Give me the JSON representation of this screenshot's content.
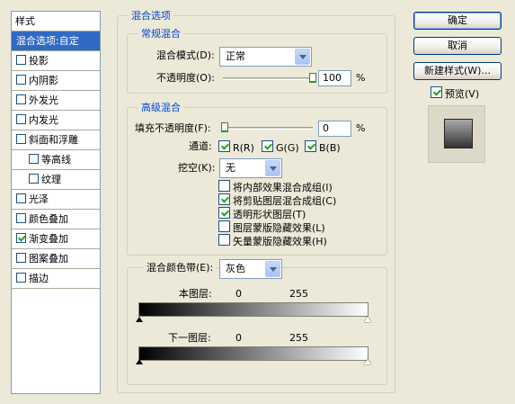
{
  "left_list": {
    "header": "样式",
    "items": [
      {
        "label": "混合选项:自定",
        "checkbox": false,
        "checked": false,
        "selected": true
      },
      {
        "label": "投影",
        "checkbox": true,
        "checked": false
      },
      {
        "label": "内阴影",
        "checkbox": true,
        "checked": false
      },
      {
        "label": "外发光",
        "checkbox": true,
        "checked": false
      },
      {
        "label": "内发光",
        "checkbox": true,
        "checked": false
      },
      {
        "label": "斜面和浮雕",
        "checkbox": true,
        "checked": false
      },
      {
        "label": "等高线",
        "checkbox": true,
        "checked": false,
        "indent": true
      },
      {
        "label": "纹理",
        "checkbox": true,
        "checked": false,
        "indent": true
      },
      {
        "label": "光泽",
        "checkbox": true,
        "checked": false
      },
      {
        "label": "颜色叠加",
        "checkbox": true,
        "checked": false
      },
      {
        "label": "渐变叠加",
        "checkbox": true,
        "checked": true
      },
      {
        "label": "图案叠加",
        "checkbox": true,
        "checked": false
      },
      {
        "label": "描边",
        "checkbox": true,
        "checked": false
      }
    ]
  },
  "blend_options": {
    "title": "混合选项",
    "general": {
      "title": "常规混合",
      "mode_label": "混合模式",
      "mode_key": "(D):",
      "mode_value": "正常",
      "opacity_label": "不透明度",
      "opacity_key": "(O):",
      "opacity_value": "100",
      "opacity_unit": "%",
      "opacity_level": 100
    },
    "advanced": {
      "title": "高级混合",
      "fill_label": "填充不透明度",
      "fill_key": "(F):",
      "fill_value": "0",
      "fill_unit": "%",
      "fill_level": 0,
      "channels_label": "通道:",
      "channels": [
        {
          "label": "R(R)",
          "checked": true
        },
        {
          "label": "G(G)",
          "checked": true
        },
        {
          "label": "B(B)",
          "checked": true
        }
      ],
      "knockout_label": "挖空",
      "knockout_key": "(K):",
      "knockout_value": "无",
      "options": [
        {
          "label": "将内部效果混合成组(I)",
          "checked": false
        },
        {
          "label": "将剪贴图层混合成组(C)",
          "checked": true
        },
        {
          "label": "透明形状图层(T)",
          "checked": true
        },
        {
          "label": "图层蒙版隐藏效果(L)",
          "checked": false
        },
        {
          "label": "矢量蒙版隐藏效果(H)",
          "checked": false
        }
      ]
    },
    "blend_if": {
      "label": "混合颜色带",
      "key": "(E):",
      "value": "灰色",
      "this_layer_label": "本图层:",
      "this_layer_min": "0",
      "this_layer_max": "255",
      "underlying_label": "下一图层:",
      "underlying_min": "0",
      "underlying_max": "255"
    }
  },
  "buttons": {
    "ok": "确定",
    "cancel": "取消",
    "new_style": "新建样式(W)...",
    "preview_label": "预览(V)",
    "preview_checked": true
  }
}
